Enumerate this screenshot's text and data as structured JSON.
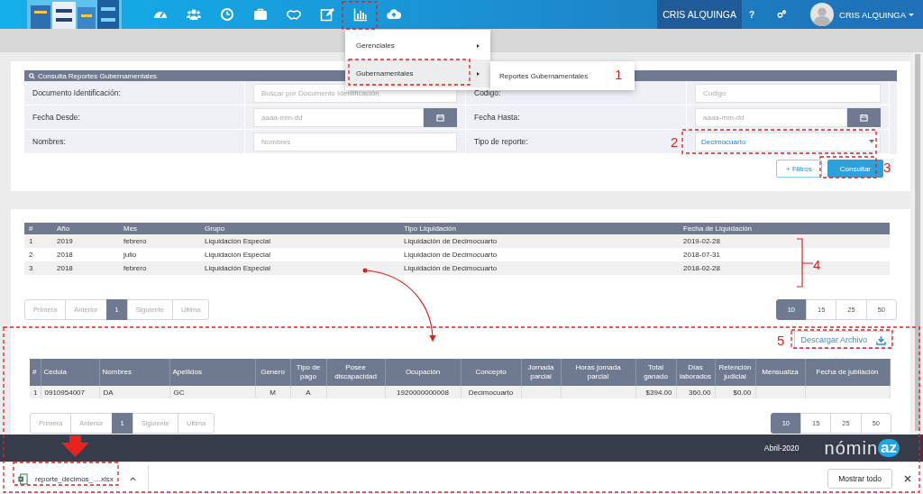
{
  "nav": {
    "company": "CRIS ALQUINGA",
    "help": "?",
    "user": "CRIS ALQUINGA"
  },
  "menu": {
    "items": [
      {
        "label": "Gerenciales",
        "selected": false
      },
      {
        "label": "Gubernamentales",
        "selected": true
      }
    ],
    "submenu": [
      "Reportes Gubernamentales"
    ]
  },
  "search_panel": {
    "title": "Consulta Reportes Gubernamentales",
    "fields": [
      {
        "label": "Documento Identificación:",
        "placeholder": "Buscar por Documento Identificación",
        "kind": "text"
      },
      {
        "label": "Codigo:",
        "placeholder": "Codigo",
        "kind": "text"
      },
      {
        "label": "Fecha Desde:",
        "placeholder": "aaaa-mm-dd",
        "kind": "date"
      },
      {
        "label": "Fecha Hasta:",
        "placeholder": "aaaa-mm-dd",
        "kind": "date"
      },
      {
        "label": "Nombres:",
        "placeholder": "Nombres",
        "kind": "text"
      },
      {
        "label": "Tipo de reporte:",
        "value": "Decimocuarto",
        "kind": "select"
      }
    ],
    "buttons": [
      {
        "label": "+ Filtros",
        "kind": "outline"
      },
      {
        "label": "Consultar",
        "kind": "primary"
      }
    ]
  },
  "results": {
    "columns": [
      "#",
      "Año",
      "Mes",
      "Grupo",
      "Tipo Liquidación",
      "Fecha de Liquidación"
    ],
    "rows": [
      [
        "1",
        "2019",
        "febrero",
        "Liquidación Especial",
        "Liquidación de Decimocuarto",
        "2019-02-28"
      ],
      [
        "2",
        "2018",
        "julio",
        "Liquidación Especial",
        "Liquidación de Decimocuarto",
        "2018-07-31"
      ],
      [
        "3",
        "2018",
        "febrero",
        "Liquidación Especial",
        "Liquidación de Decimocuarto",
        "2018-02-28"
      ]
    ],
    "pagination": [
      {
        "label": "Primera",
        "selected": false
      },
      {
        "label": "Anterior",
        "selected": false
      },
      {
        "label": "1",
        "selected": true
      },
      {
        "label": "Siguiente",
        "selected": false
      },
      {
        "label": "Ultima",
        "selected": false
      }
    ],
    "page_sizes": [
      {
        "label": "10",
        "selected": true
      },
      {
        "label": "15",
        "selected": false
      },
      {
        "label": "25",
        "selected": false
      },
      {
        "label": "50",
        "selected": false
      }
    ]
  },
  "detail": {
    "download_button": "Descargar Archivo",
    "columns": [
      "#",
      "Cedula",
      "Nombres",
      "Apellidos",
      "Genero",
      "Tipo de pago",
      "Posee discapacidad",
      "Ocupación",
      "Concepto",
      "Jornada parcial",
      "Horas jornada parcial",
      "Total ganado",
      "Días laborados",
      "Retención judicial",
      "Mensualiza",
      "Fecha de jubilación"
    ],
    "rows": [
      [
        "1",
        "0910954007",
        "DA",
        "GC",
        "M",
        "A",
        null,
        "1920000000008",
        "Decimocuarto",
        null,
        null,
        "$394.00",
        "360.00",
        "$0.00",
        null,
        null
      ]
    ],
    "pagination": [
      {
        "label": "Primera",
        "selected": false
      },
      {
        "label": "Anterior",
        "selected": false
      },
      {
        "label": "1",
        "selected": true
      },
      {
        "label": "Siguiente",
        "selected": false
      },
      {
        "label": "Ultima",
        "selected": false
      }
    ],
    "page_sizes": [
      {
        "label": "10",
        "selected": true
      },
      {
        "label": "15",
        "selected": false
      },
      {
        "label": "25",
        "selected": false
      },
      {
        "label": "50",
        "selected": false
      }
    ]
  },
  "footer": {
    "period": "Abril-2020",
    "logo_text": "nómin",
    "logo_badge": "az"
  },
  "downloads": {
    "file": "reporte_decimos_....xlsx",
    "show_all": "Mostrar todo"
  },
  "annotations": [
    {
      "label": "1"
    },
    {
      "label": "2"
    },
    {
      "label": "3"
    },
    {
      "label": "4"
    },
    {
      "label": "5"
    }
  ]
}
